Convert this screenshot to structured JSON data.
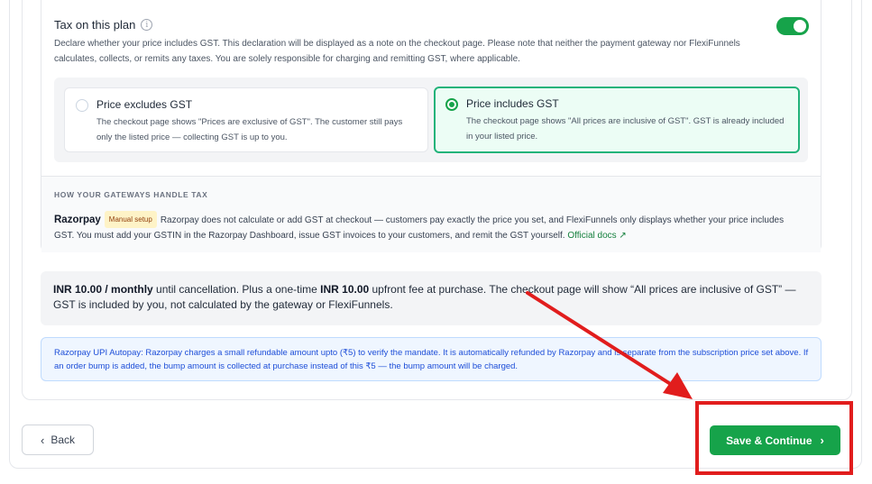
{
  "tax": {
    "title": "Tax on this plan",
    "info_icon": "i",
    "description": "Declare whether your price includes GST. This declaration will be displayed as a note on the checkout page. Please note that neither the payment gateway nor FlexiFunnels calculates, collects, or remits any taxes. You are solely responsible for charging and remitting GST, where applicable.",
    "toggle_on": true,
    "options": [
      {
        "title": "Price excludes GST",
        "desc": "The checkout page shows \"Prices are exclusive of GST\". The customer still pays only the listed price — collecting GST is up to you.",
        "selected": false
      },
      {
        "title": "Price includes GST",
        "desc": "The checkout page shows \"All prices are inclusive of GST\". GST is already included in your listed price.",
        "selected": true
      }
    ]
  },
  "gateways": {
    "heading": "HOW YOUR GATEWAYS HANDLE TAX",
    "name": "Razorpay",
    "badge": "Manual setup",
    "text": "Razorpay does not calculate or add GST at checkout — customers pay exactly the price you set, and FlexiFunnels only displays whether your price includes GST. You must add your GSTIN in the Razorpay Dashboard, issue GST invoices to your customers, and remit the GST yourself.",
    "link": "Official docs",
    "link_icon": "↗"
  },
  "summary": {
    "price": "INR 10.00 / monthly",
    "part1": " until cancellation. Plus a one-time ",
    "fee": "INR 10.00",
    "part2": " upfront fee at purchase. The checkout page will show “All prices are inclusive of GST” — GST is included by you, not calculated by the gateway or FlexiFunnels."
  },
  "autopay": {
    "text": "Razorpay UPI Autopay: Razorpay charges a small refundable amount upto (₹5) to verify the mandate. It is automatically refunded by Razorpay and is separate from the subscription price set above. If an order bump is added, the bump amount is collected at purchase instead of this ₹5 — the bump amount will be charged."
  },
  "footer": {
    "back_label": "Back",
    "back_icon": "‹",
    "save_label": "Save & Continue",
    "save_icon": "›"
  },
  "colors": {
    "primary": "#16a34a",
    "annotation": "#e11d1d"
  }
}
